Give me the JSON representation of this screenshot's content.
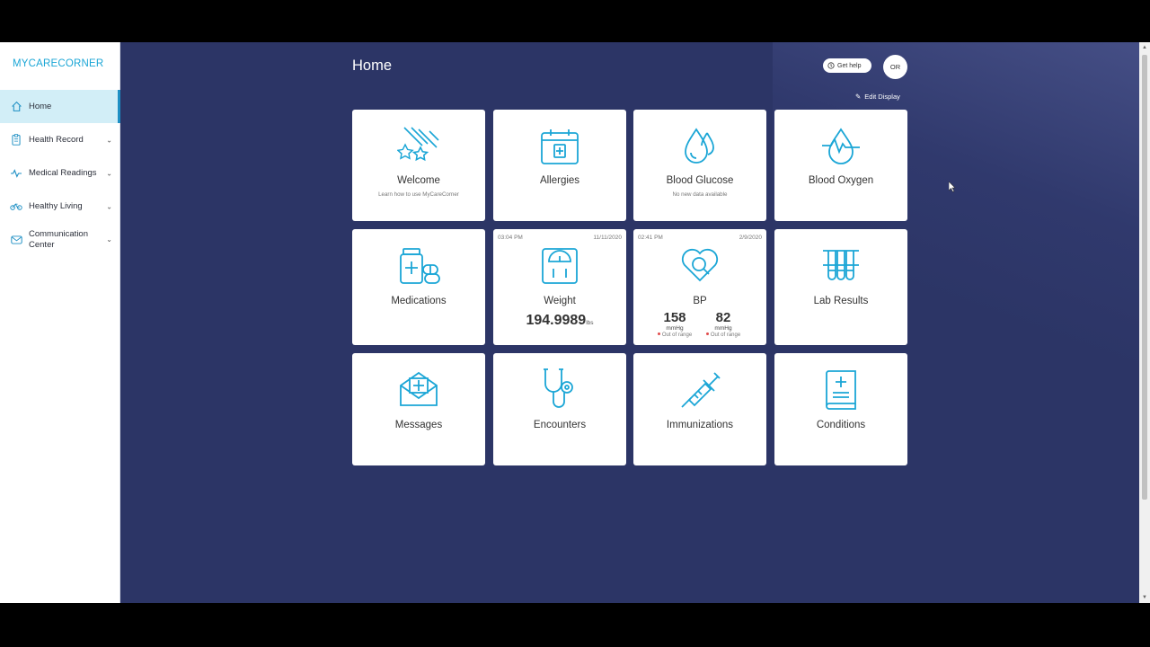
{
  "app": {
    "logo_text": "MYCARECORNER"
  },
  "sidebar": {
    "items": [
      {
        "label": "Home",
        "icon": "home-icon",
        "active": true
      },
      {
        "label": "Health Record",
        "icon": "clipboard-icon"
      },
      {
        "label": "Medical Readings",
        "icon": "readings-icon"
      },
      {
        "label": "Healthy Living",
        "icon": "bike-icon"
      },
      {
        "label": "Communication Center",
        "icon": "chat-icon"
      }
    ]
  },
  "header": {
    "title": "Home",
    "get_help": "Get help",
    "avatar_initials": "OR",
    "edit_display": "Edit Display"
  },
  "tiles": {
    "welcome": {
      "label": "Welcome",
      "sub": "Learn how to use MyCareCorner"
    },
    "allergies": {
      "label": "Allergies"
    },
    "glucose": {
      "label": "Blood Glucose",
      "sub": "No new data available"
    },
    "oxygen": {
      "label": "Blood Oxygen"
    },
    "medications": {
      "label": "Medications"
    },
    "weight": {
      "label": "Weight",
      "time": "03:04 PM",
      "date": "11/11/2020",
      "value": "194.9989",
      "unit": "lbs"
    },
    "bp": {
      "label": "BP",
      "time": "02:41 PM",
      "date": "2/9/2020",
      "systolic": "158",
      "diastolic": "82",
      "unit": "mmHg",
      "status": "Out of range"
    },
    "lab": {
      "label": "Lab Results"
    },
    "messages": {
      "label": "Messages"
    },
    "encounters": {
      "label": "Encounters"
    },
    "immunizations": {
      "label": "Immunizations"
    },
    "conditions": {
      "label": "Conditions"
    }
  },
  "colors": {
    "accent": "#1ba6d6",
    "background": "#2c3566",
    "active_nav": "#d2eef7"
  }
}
